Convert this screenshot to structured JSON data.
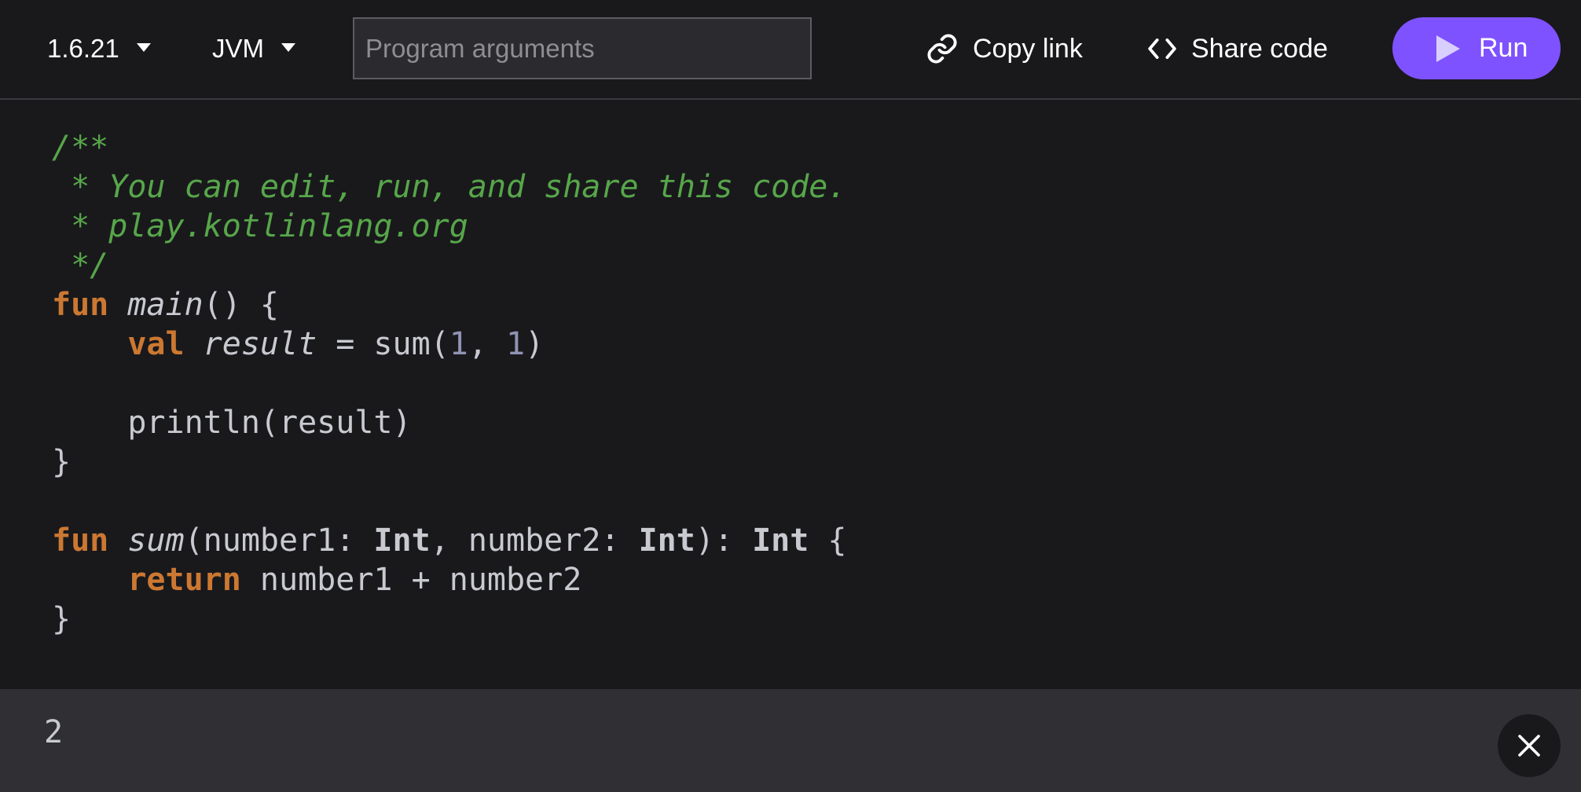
{
  "toolbar": {
    "version_dropdown": {
      "value": "1.6.21",
      "icon": "caret-down-icon"
    },
    "target_dropdown": {
      "value": "JVM",
      "icon": "caret-down-icon"
    },
    "program_args": {
      "placeholder": "Program arguments",
      "value": ""
    },
    "copy_link": {
      "label": "Copy link",
      "icon": "link-icon"
    },
    "share_code": {
      "label": "Share code",
      "icon": "code-brackets-icon"
    },
    "run": {
      "label": "Run",
      "icon": "play-icon",
      "color": "#7f52ff"
    }
  },
  "editor": {
    "lines": [
      [
        {
          "t": "comment",
          "v": "/**"
        }
      ],
      [
        {
          "t": "comment",
          "v": " * You can edit, run, and share this code."
        }
      ],
      [
        {
          "t": "comment",
          "v": " * play.kotlinlang.org"
        }
      ],
      [
        {
          "t": "comment",
          "v": " */"
        }
      ],
      [
        {
          "t": "keyword",
          "v": "fun"
        },
        {
          "t": "plain",
          "v": " "
        },
        {
          "t": "fn",
          "v": "main"
        },
        {
          "t": "plain",
          "v": "() {"
        }
      ],
      [
        {
          "t": "plain",
          "v": "    "
        },
        {
          "t": "keyword",
          "v": "val"
        },
        {
          "t": "plain",
          "v": " "
        },
        {
          "t": "var",
          "v": "result"
        },
        {
          "t": "plain",
          "v": " = sum("
        },
        {
          "t": "num",
          "v": "1"
        },
        {
          "t": "plain",
          "v": ", "
        },
        {
          "t": "num",
          "v": "1"
        },
        {
          "t": "plain",
          "v": ")"
        }
      ],
      [],
      [
        {
          "t": "plain",
          "v": "    println(result)"
        }
      ],
      [
        {
          "t": "plain",
          "v": "}"
        }
      ],
      [],
      [
        {
          "t": "keyword",
          "v": "fun"
        },
        {
          "t": "plain",
          "v": " "
        },
        {
          "t": "fn",
          "v": "sum"
        },
        {
          "t": "plain",
          "v": "(number1: "
        },
        {
          "t": "type",
          "v": "Int"
        },
        {
          "t": "plain",
          "v": ", number2: "
        },
        {
          "t": "type",
          "v": "Int"
        },
        {
          "t": "plain",
          "v": "): "
        },
        {
          "t": "type",
          "v": "Int"
        },
        {
          "t": "plain",
          "v": " {"
        }
      ],
      [
        {
          "t": "plain",
          "v": "    "
        },
        {
          "t": "keyword",
          "v": "return"
        },
        {
          "t": "plain",
          "v": " number1 + number2"
        }
      ],
      [
        {
          "t": "plain",
          "v": "}"
        }
      ]
    ],
    "help": {
      "label": "?",
      "icon": "question-icon"
    }
  },
  "output": {
    "text": "2",
    "close_icon": "close-icon"
  },
  "colors": {
    "background": "#19191c",
    "output_background": "#303034",
    "comment": "#57a64a",
    "keyword": "#cc7832",
    "number": "#8f93b4",
    "accent": "#7f52ff"
  }
}
